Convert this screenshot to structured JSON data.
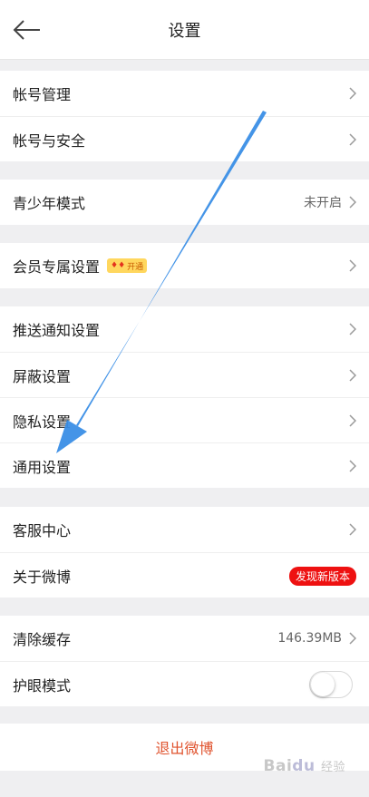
{
  "header": {
    "title": "设置"
  },
  "groups": [
    {
      "items": [
        {
          "label": "帐号管理"
        },
        {
          "label": "帐号与安全"
        }
      ]
    },
    {
      "items": [
        {
          "label": "青少年模式",
          "value": "未开启"
        }
      ]
    },
    {
      "items": [
        {
          "label": "会员专属设置",
          "badge": "开通"
        }
      ]
    },
    {
      "items": [
        {
          "label": "推送通知设置"
        },
        {
          "label": "屏蔽设置"
        },
        {
          "label": "隐私设置"
        },
        {
          "label": "通用设置"
        }
      ]
    },
    {
      "items": [
        {
          "label": "客服中心"
        },
        {
          "label": "关于微博",
          "badge": "发现新版本"
        }
      ]
    },
    {
      "items": [
        {
          "label": "清除缓存",
          "value": "146.39MB"
        },
        {
          "label": "护眼模式",
          "toggle": false
        }
      ]
    }
  ],
  "logout": {
    "label": "退出微博"
  },
  "watermark": {
    "text": "Bai",
    "paw": "du",
    "sub": "经验"
  },
  "colors": {
    "accent": "#e0532e",
    "badge_red": "#ee1111",
    "annotation_arrow": "#3a8ee6"
  }
}
